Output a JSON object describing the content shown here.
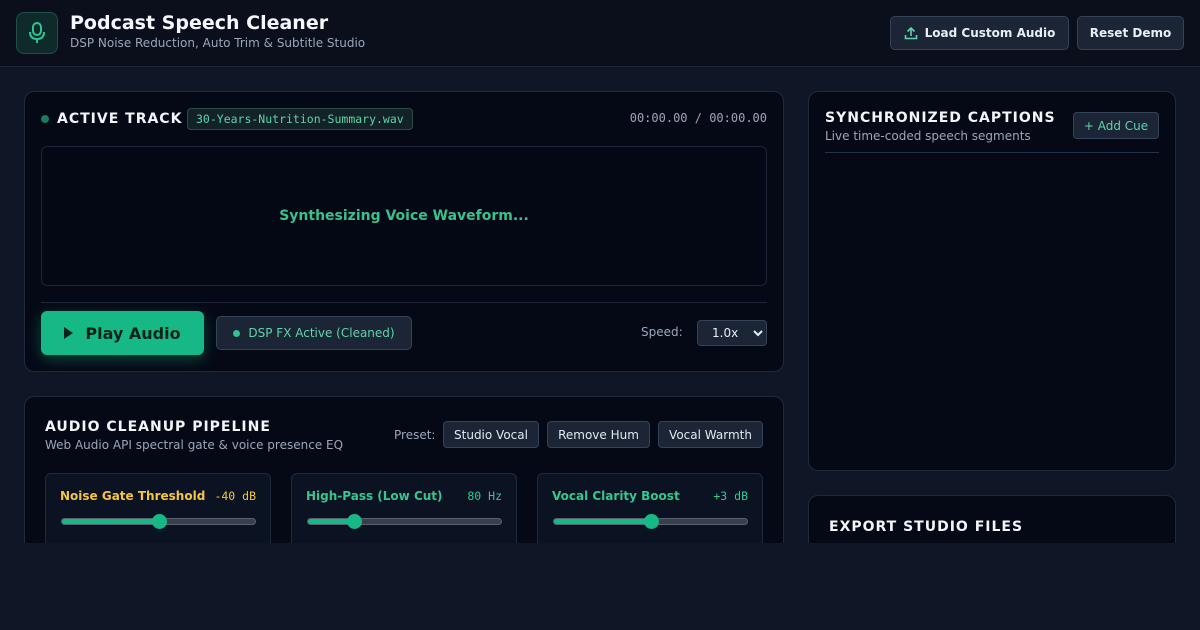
{
  "header": {
    "title": "Podcast Speech Cleaner",
    "subtitle": "DSP Noise Reduction, Auto Trim & Subtitle Studio",
    "load_label": "Load Custom Audio",
    "reset_label": "Reset Demo",
    "logo_icon": "microphone-icon",
    "upload_icon": "upload-icon"
  },
  "track": {
    "label": "ACTIVE TRACK",
    "filename": "30-Years-Nutrition-Summary.wav",
    "time": "00:00.00 / 00:00.00",
    "waveform_status": "Synthesizing Voice Waveform...",
    "play_label": "Play Audio",
    "fx_label": "DSP FX Active (Cleaned)",
    "speed_label": "Speed:",
    "speed_value": "1.0x"
  },
  "pipeline": {
    "title": "AUDIO CLEANUP PIPELINE",
    "subtitle": "Web Audio API spectral gate & voice presence EQ",
    "preset_label": "Preset:",
    "presets": [
      "Studio Vocal",
      "Remove Hum",
      "Vocal Warmth"
    ],
    "controls": [
      {
        "label": "Noise Gate Threshold",
        "value": "-40 dB",
        "level": 0.5,
        "color": "#f5c542"
      },
      {
        "label": "High-Pass (Low Cut)",
        "value": "80 Hz",
        "level": 0.24,
        "color": "#34c790"
      },
      {
        "label": "Vocal Clarity Boost",
        "value": "+3 dB",
        "level": 0.5,
        "color": "#34c790"
      }
    ]
  },
  "captions": {
    "title": "SYNCHRONIZED CAPTIONS",
    "subtitle": "Live time-coded speech segments",
    "add_label": "+ Add Cue"
  },
  "export": {
    "title": "EXPORT STUDIO FILES"
  },
  "colors": {
    "accent": "#16b985",
    "warning": "#f5c542",
    "background": "#0f1626",
    "card": "#050916"
  }
}
